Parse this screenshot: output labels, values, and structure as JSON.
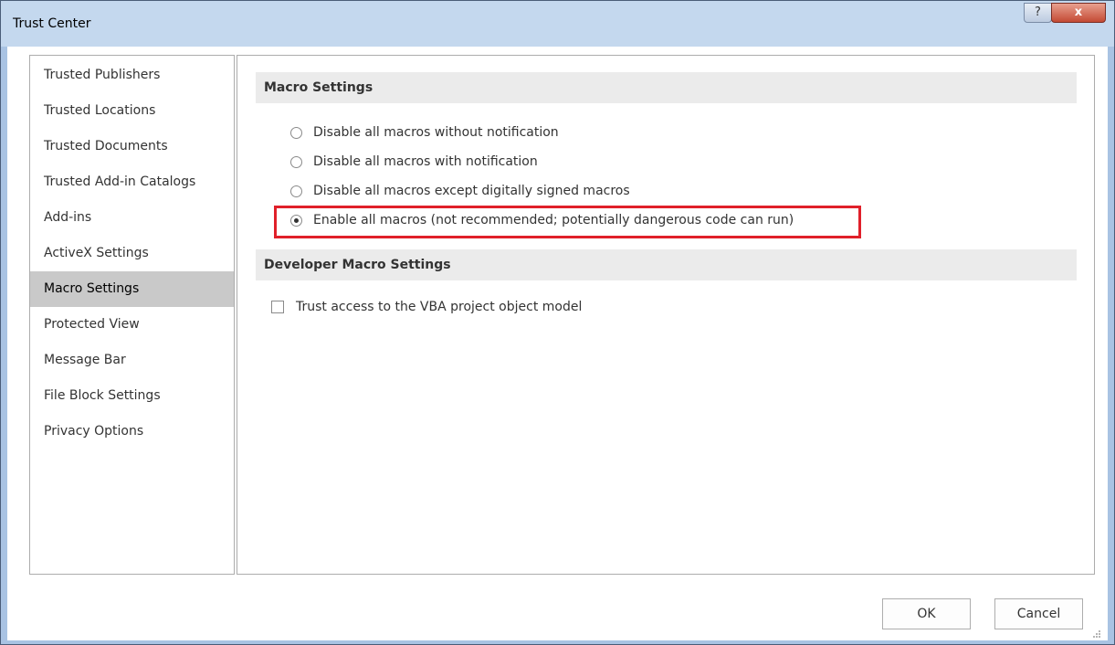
{
  "window": {
    "title": "Trust Center",
    "help_icon_text": "?",
    "close_icon_text": "x"
  },
  "nav": {
    "items": [
      {
        "label": "Trusted Publishers"
      },
      {
        "label": "Trusted Locations"
      },
      {
        "label": "Trusted Documents"
      },
      {
        "label": "Trusted Add-in Catalogs"
      },
      {
        "label": "Add-ins"
      },
      {
        "label": "ActiveX Settings"
      },
      {
        "label": "Macro Settings"
      },
      {
        "label": "Protected View"
      },
      {
        "label": "Message Bar"
      },
      {
        "label": "File Block Settings"
      },
      {
        "label": "Privacy Options"
      }
    ],
    "selected": "Macro Settings"
  },
  "macro_settings": {
    "header": "Macro Settings",
    "options": [
      {
        "label": "Disable all macros without notification",
        "selected": false
      },
      {
        "label": "Disable all macros with notification",
        "selected": false
      },
      {
        "label": "Disable all macros except digitally signed macros",
        "selected": false
      },
      {
        "label": "Enable all macros (not recommended; potentially dangerous code can run)",
        "selected": true
      }
    ]
  },
  "developer_settings": {
    "header": "Developer Macro Settings",
    "trust_vba_label": "Trust access to the VBA project object model",
    "trust_vba_checked": false
  },
  "footer": {
    "ok_label": "OK",
    "cancel_label": "Cancel"
  },
  "colors": {
    "highlight": "#e0202a",
    "selected_nav": "#c9c9c9",
    "section_header_bg": "#ebebeb"
  }
}
